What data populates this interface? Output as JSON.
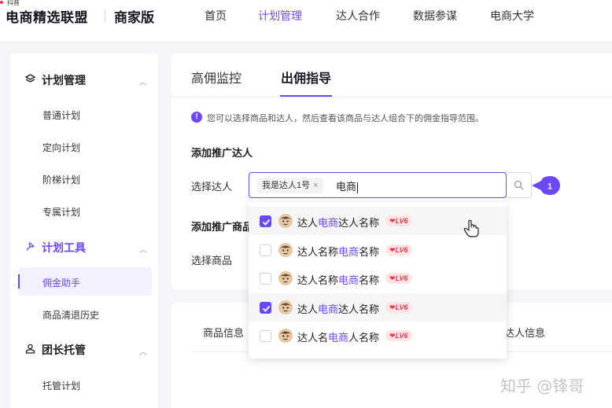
{
  "brand": {
    "small": "抖音",
    "title": "电商精选联盟",
    "subtitle": "商家版"
  },
  "nav": [
    {
      "label": "首页",
      "active": false
    },
    {
      "label": "计划管理",
      "active": true
    },
    {
      "label": "达人合作",
      "active": false
    },
    {
      "label": "数据参谋",
      "active": false
    },
    {
      "label": "电商大学",
      "active": false
    }
  ],
  "sidebar": {
    "groups": [
      {
        "label": "计划管理",
        "icon": "layers-icon",
        "items": [
          "普通计划",
          "定向计划",
          "阶梯计划",
          "专属计划"
        ]
      },
      {
        "label": "计划工具",
        "icon": "tool-icon",
        "items": [
          "佣金助手",
          "商品清退历史"
        ]
      },
      {
        "label": "团长托管",
        "icon": "user-group-icon",
        "items": [
          "托管计划"
        ]
      }
    ],
    "active_item": "佣金助手"
  },
  "tabs": [
    {
      "label": "高佣监控",
      "active": false
    },
    {
      "label": "出佣指导",
      "active": true
    }
  ],
  "info": {
    "icon": "info-icon",
    "text": "您可以选择商品和达人，然后查看该商品与达人组合下的佣金指导范围。"
  },
  "form": {
    "section_creator": "添加推广达人",
    "select_creator_label": "选择达人",
    "selected_tag": "我是达人1号",
    "typed_value": "电商",
    "section_product": "添加推广商品",
    "select_product_label": "选择商品",
    "step_badge": "1"
  },
  "dropdown": {
    "options": [
      {
        "pre": "达人",
        "hl": "电商",
        "post": "达人名称",
        "level": "LV6",
        "checked": true,
        "hovered": true
      },
      {
        "pre": "达人名称",
        "hl": "电商",
        "post": "名称",
        "level": "LV6",
        "checked": false,
        "hovered": false
      },
      {
        "pre": "达人名称",
        "hl": "电商",
        "post": "名称",
        "level": "LV6",
        "checked": false,
        "hovered": false
      },
      {
        "pre": "达人",
        "hl": "电商",
        "post": "达人名称",
        "level": "LV6",
        "checked": true,
        "hovered": true
      },
      {
        "pre": "达人名",
        "hl": "电商",
        "post": "人名称",
        "level": "LV6",
        "checked": false,
        "hovered": false
      }
    ]
  },
  "table": {
    "headers": [
      "商品信息",
      "达人信息"
    ]
  },
  "watermark": "知乎 @锋哥",
  "colors": {
    "accent": "#6b47f5",
    "level_badge": "#f2364d"
  }
}
